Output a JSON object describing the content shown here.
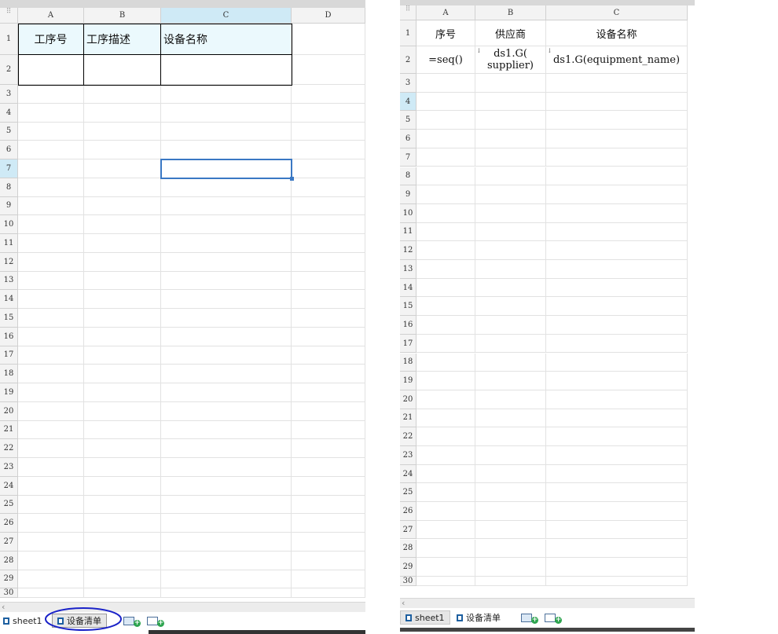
{
  "left": {
    "columns": [
      {
        "label": "A",
        "selected": false
      },
      {
        "label": "B",
        "selected": false
      },
      {
        "label": "C",
        "selected": true
      },
      {
        "label": "D",
        "selected": false
      }
    ],
    "rows": [
      "1",
      "2",
      "3",
      "4",
      "5",
      "6",
      "7",
      "8",
      "9",
      "10",
      "11",
      "12",
      "13",
      "14",
      "15",
      "16",
      "17",
      "18",
      "19",
      "20",
      "21",
      "22",
      "23",
      "24",
      "25",
      "26",
      "27",
      "28",
      "29",
      "30"
    ],
    "selected_row": "7",
    "selected_cell": "C7",
    "cells": [
      {
        "col": 0,
        "row": 0,
        "text": "工序号",
        "align": "center"
      },
      {
        "col": 1,
        "row": 0,
        "text": "工序描述",
        "align": "left"
      },
      {
        "col": 2,
        "row": 0,
        "text": "设备名称",
        "align": "left"
      }
    ],
    "tabs": [
      {
        "label": "sheet1",
        "active": false
      },
      {
        "label": "设备清单",
        "active": true
      }
    ]
  },
  "right": {
    "columns": [
      {
        "label": "A",
        "selected": false
      },
      {
        "label": "B",
        "selected": false
      },
      {
        "label": "C",
        "selected": false
      }
    ],
    "rows": [
      "1",
      "2",
      "3",
      "4",
      "5",
      "6",
      "7",
      "8",
      "9",
      "10",
      "11",
      "12",
      "13",
      "14",
      "15",
      "16",
      "17",
      "18",
      "19",
      "20",
      "21",
      "22",
      "23",
      "24",
      "25",
      "26",
      "27",
      "28",
      "29",
      "30"
    ],
    "selected_row": "4",
    "cells": [
      {
        "col": 0,
        "row": 0,
        "text": "序号",
        "align": "center"
      },
      {
        "col": 1,
        "row": 0,
        "text": "供应商",
        "align": "center"
      },
      {
        "col": 2,
        "row": 0,
        "text": "设备名称",
        "align": "center"
      },
      {
        "col": 0,
        "row": 1,
        "text": "=seq()",
        "align": "center"
      },
      {
        "col": 1,
        "row": 1,
        "text": "ds1.G( supplier)",
        "align": "center",
        "wrap": true,
        "expand_marker": "↓"
      },
      {
        "col": 2,
        "row": 1,
        "text": "ds1.G(equipment_name)",
        "align": "center",
        "expand_marker": "↓"
      }
    ],
    "tabs": [
      {
        "label": "sheet1",
        "active": false
      },
      {
        "label": "设备清单",
        "active": true
      }
    ]
  },
  "icons": {
    "add_sheet": "add-sheet-icon",
    "add_report": "add-report-icon",
    "scroll_left": "‹"
  },
  "colors": {
    "header_bg": "#f3f3f3",
    "header_selected": "#cfeaf6",
    "cell_highlight": "#ebf9fd",
    "selection_border": "#3a78c4",
    "annotation_circle": "#1a22c8"
  }
}
